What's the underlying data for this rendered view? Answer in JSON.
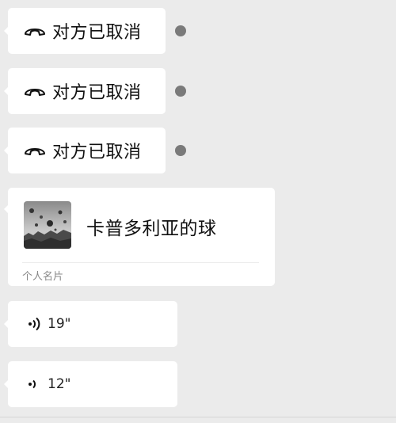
{
  "messages": {
    "call1": {
      "icon": "phone-hangup-icon",
      "text": "对方已取消"
    },
    "call2": {
      "icon": "phone-hangup-icon",
      "text": "对方已取消"
    },
    "call3": {
      "icon": "phone-hangup-icon",
      "text": "对方已取消"
    },
    "card": {
      "name": "卡普多利亚的球",
      "type_label": "个人名片",
      "avatar_icon": "hot-air-balloon-photo"
    },
    "voice1": {
      "icon": "voice-wave-icon",
      "duration": "19\""
    },
    "voice2": {
      "icon": "voice-wave-icon",
      "duration": "12\""
    }
  },
  "colors": {
    "background": "#ebebeb",
    "bubble": "#ffffff",
    "unread_dot": "#7a7a7a"
  }
}
